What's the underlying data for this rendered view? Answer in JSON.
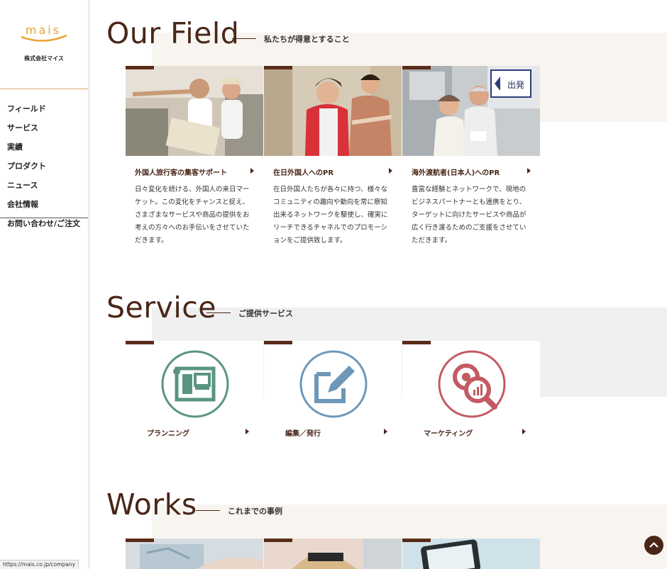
{
  "sidebar": {
    "logo_text": "mais",
    "company": "株式会社マイス",
    "nav": [
      {
        "label": "フィールド"
      },
      {
        "label": "サービス"
      },
      {
        "label": "実績"
      },
      {
        "label": "プロダクト"
      },
      {
        "label": "ニュース"
      },
      {
        "label": "会社情報"
      },
      {
        "label": "お問い合わせ/ご注文"
      }
    ]
  },
  "field": {
    "title": "Our Field",
    "subtitle": "私たちが得意とすること",
    "cards": [
      {
        "title": "外国人旅行客の集客サポート",
        "text": "日々変化を続ける、外国人の来日マーケット。この変化をチャンスと捉え、さまざまなサービスや商品の提供をお考えの方々へのお手伝いをさせていただきます。"
      },
      {
        "title": "在日外国人へのPR",
        "text": "在日外国人たちが各々に持つ、様々なコミュニティの趣向や動向を常に察知出来るネットワークを駆使し、確実にリーチできるチャネルでのプロモーションをご提供致します。"
      },
      {
        "title": "海外渡航者(日本人)へのPR",
        "text": "豊富な経験とネットワークで、現地のビジネスパートナーとも連携をとり、ターゲットに向けたサービスや商品が広く行き渡るためのご支援をさせていただきます。"
      }
    ],
    "sign_text": "出発"
  },
  "service": {
    "title": "Service",
    "subtitle": "ご提供サービス",
    "cards": [
      {
        "label": "プランニング",
        "color": "#5a9482"
      },
      {
        "label": "編集／発行",
        "color": "#6e98b9"
      },
      {
        "label": "マーケティング",
        "color": "#c45a62"
      }
    ]
  },
  "works": {
    "title": "Works",
    "subtitle": "これまでの事例"
  },
  "status_url": "https://mais.co.jp/company",
  "colors": {
    "brown": "#4a2618",
    "accent": "#e8a22e",
    "beige": "#f8f5f0",
    "gray": "#f0f0f0"
  }
}
